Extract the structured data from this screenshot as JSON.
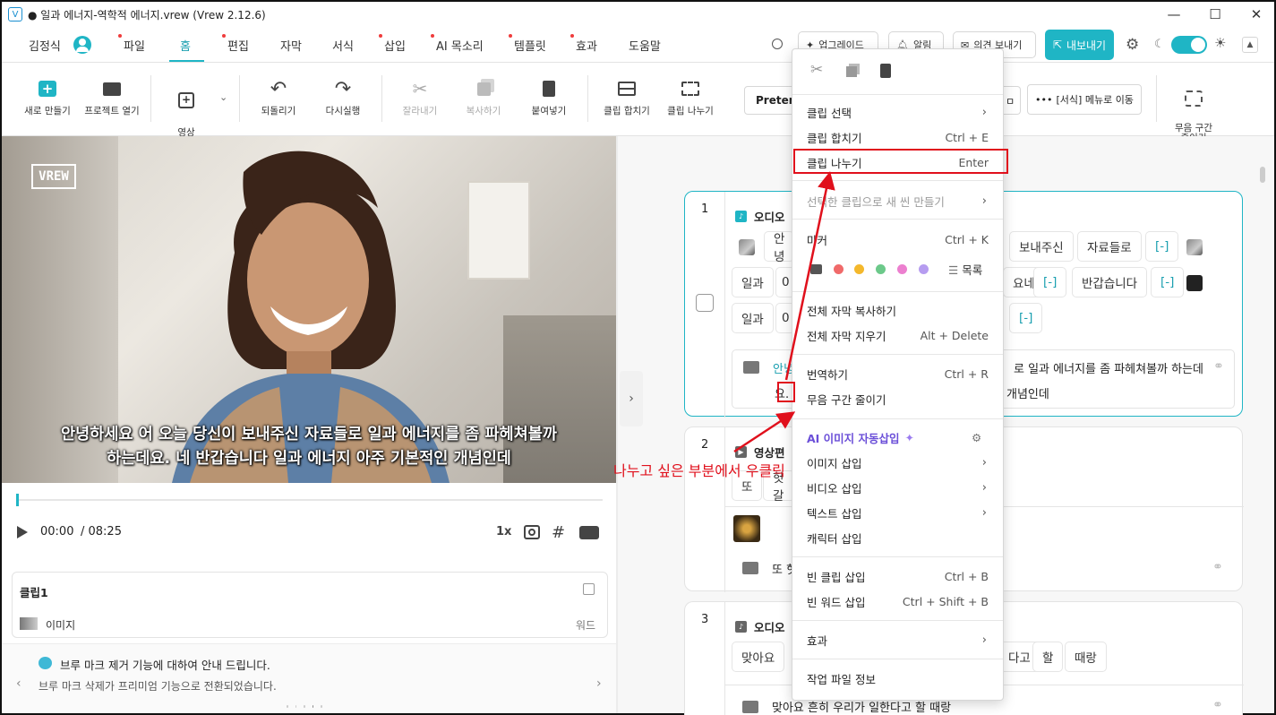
{
  "window": {
    "title": "● 일과 에너지-역학적 에너지.vrew (Vrew 2.12.6)",
    "minimize": "—",
    "maximize": "☐",
    "close": "✕"
  },
  "menubar": {
    "user": "김정식",
    "items": [
      "파일",
      "홈",
      "편집",
      "자막",
      "서식",
      "삽입",
      "AI 목소리",
      "템플릿",
      "효과",
      "도움말"
    ],
    "upgrade": "업그레이드",
    "alarm": "알림",
    "feedback": "의견 보내기",
    "export": "내보내기"
  },
  "toolbar": {
    "new": "새로 만들기",
    "open": "프로젝트 열기",
    "add_video": "영상\n추가하기",
    "undo": "되돌리기",
    "redo": "다시실행",
    "cut": "잘라내기",
    "copy": "복사하기",
    "paste": "붙여넣기",
    "merge": "클립 합치기",
    "split": "클립 나누기",
    "font": "Pretend",
    "format_menu": "[서식] 메뉴로 이동",
    "reduce_silence": "무음 구간\n줄이기"
  },
  "video": {
    "logo": "VREW",
    "subtitle_line1": "안녕하세요 어 오늘 당신이 보내주신 자료들로 일과 에너지를 좀 파헤쳐볼까",
    "subtitle_line2": "하는데요. 네 반갑습니다 일과 에너지 아주 기본적인 개념인데"
  },
  "player": {
    "current": "00:00",
    "total": "/ 08:25",
    "speed": "1x"
  },
  "clip_panel": {
    "title": "클립1",
    "row_label": "이미지",
    "row_right": "워드"
  },
  "notice": {
    "title": "브루 마크 제거 기능에 대하여 안내 드립니다.",
    "body": "브루 마크 삭제가 프리미엄 기능으로 전환되었습니다."
  },
  "clips": [
    {
      "num": "1",
      "track": "오디오",
      "row1": [
        "안녕",
        "보내주신",
        "자료들로",
        "[-]"
      ],
      "row2": [
        "일과",
        "0",
        "요네",
        "[-]",
        "반갑습니다",
        "[-]"
      ],
      "row3": [
        "일과",
        "0",
        "[-]"
      ],
      "sub_a": "안녕",
      "sub_b": "로 일과 에너지를 좀 파헤쳐볼까 하는데",
      "sub_c": "요.",
      "sub_d": "개념인데"
    },
    {
      "num": "2",
      "track": "영상편",
      "row1": [
        "또",
        "헛갈"
      ],
      "sub": "또 헛"
    },
    {
      "num": "3",
      "track": "오디오",
      "row1": [
        "맞아요",
        "다고",
        "할",
        "때랑"
      ],
      "sub": "맞아요 흔히 우리가 일한다고 할 때랑"
    }
  ],
  "context_menu": {
    "select_clip": "클립 선택",
    "merge_clip": "클립 합치기",
    "merge_sc": "Ctrl + E",
    "split_clip": "클립 나누기",
    "split_sc": "Enter",
    "new_scene": "선택한 클립으로 새 씬 만들기",
    "marker": "마커",
    "marker_sc": "Ctrl + K",
    "marker_list": "목록",
    "copy_all": "전체 자막 복사하기",
    "delete_all": "전체 자막 지우기",
    "delete_sc": "Alt + Delete",
    "translate": "번역하기",
    "translate_sc": "Ctrl + R",
    "reduce_silence": "무음 구간 줄이기",
    "ai_image": "AI 이미지 자동삽입",
    "insert_image": "이미지 삽입",
    "insert_video": "비디오 삽입",
    "insert_text": "텍스트 삽입",
    "insert_char": "캐릭터 삽입",
    "empty_clip": "빈 클립 삽입",
    "empty_clip_sc": "Ctrl + B",
    "empty_word": "빈 워드 삽입",
    "empty_word_sc": "Ctrl + Shift + B",
    "effect": "효과",
    "file_info": "작업 파일 정보"
  },
  "annotation": {
    "text": "나누고 싶은 부분에서 우클릭"
  },
  "colors": {
    "accent": "#1fb5c5",
    "annotation": "#e0101c",
    "ai": "#6b4fd8"
  }
}
